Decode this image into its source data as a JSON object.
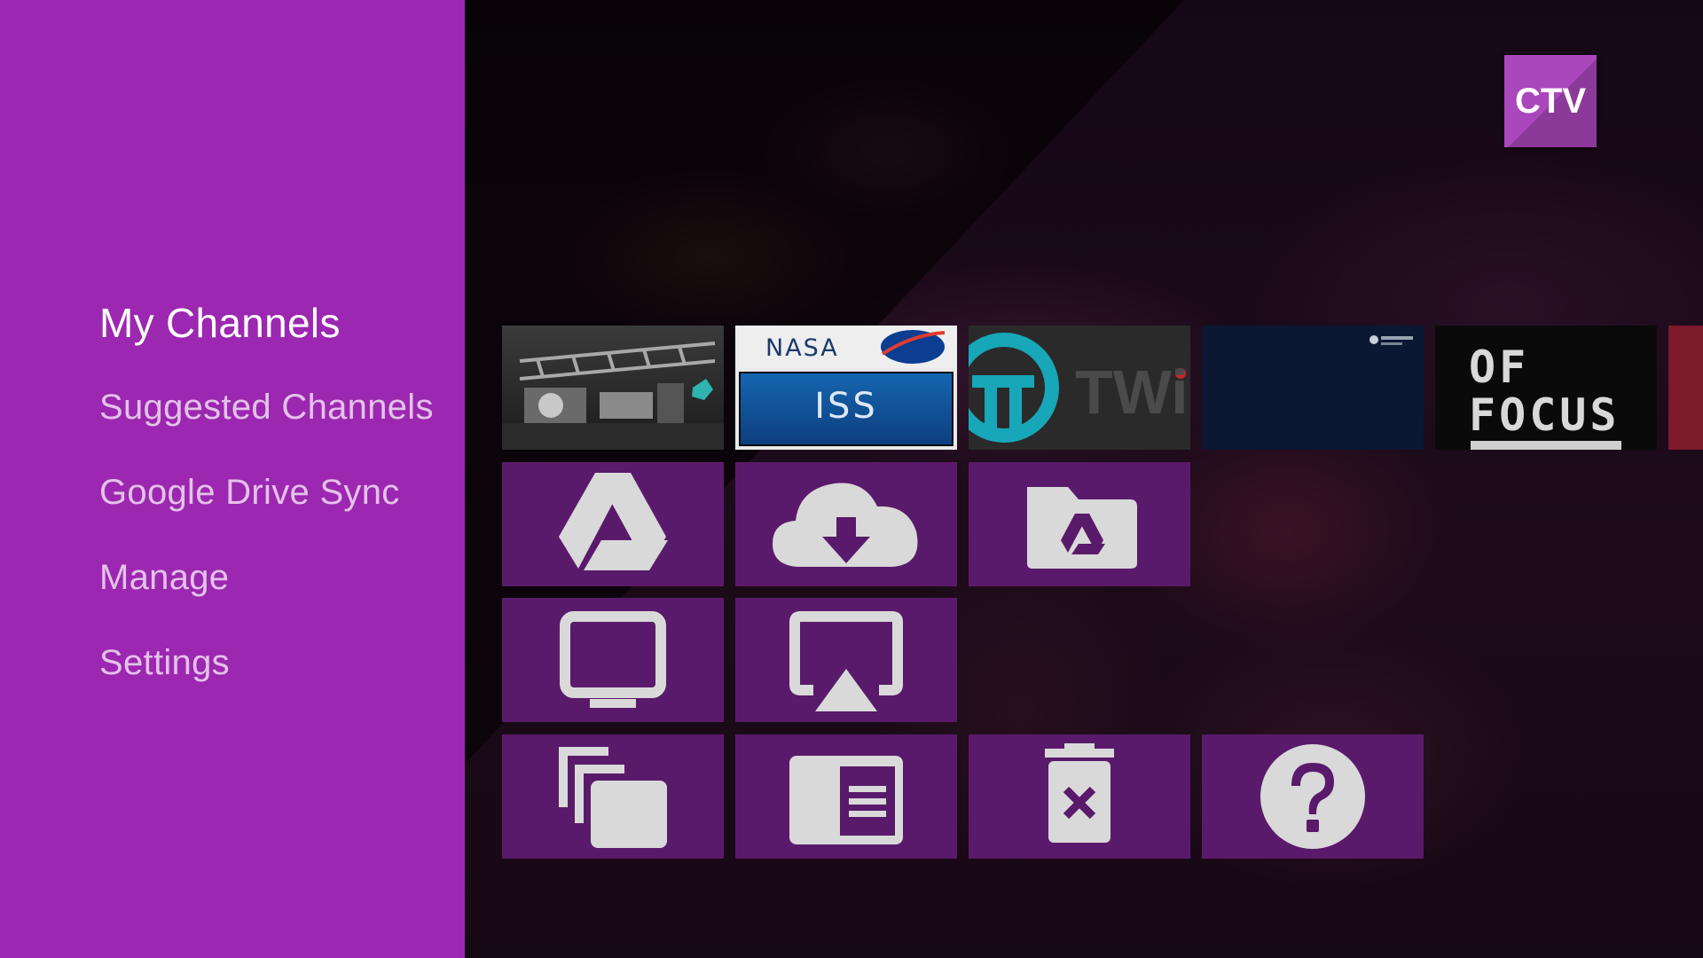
{
  "app": {
    "logo_text": "CTV"
  },
  "sidebar": {
    "items": [
      {
        "label": "My Channels",
        "active": true
      },
      {
        "label": "Suggested Channels",
        "active": false
      },
      {
        "label": "Google Drive Sync",
        "active": false
      },
      {
        "label": "Manage",
        "active": false
      },
      {
        "label": "Settings",
        "active": false
      }
    ]
  },
  "channels": {
    "nasa_label": "NASA",
    "iss_label": "ISS",
    "twit_label": "TWi",
    "focus_lines": [
      "OF",
      "FOCUS"
    ]
  },
  "actions": [
    {
      "icon": "google-drive-icon"
    },
    {
      "icon": "cloud-download-icon"
    },
    {
      "icon": "drive-folder-icon"
    },
    {
      "icon": "tv-icon"
    },
    {
      "icon": "airplay-icon"
    },
    {
      "icon": "copy-icon"
    },
    {
      "icon": "list-view-icon"
    },
    {
      "icon": "delete-icon"
    },
    {
      "icon": "help-icon"
    }
  ],
  "colors": {
    "sidebar": "#9c27b0",
    "tile": "#5a1a6b",
    "icon": "#d9d9d9",
    "logo": "#ab47bc"
  }
}
